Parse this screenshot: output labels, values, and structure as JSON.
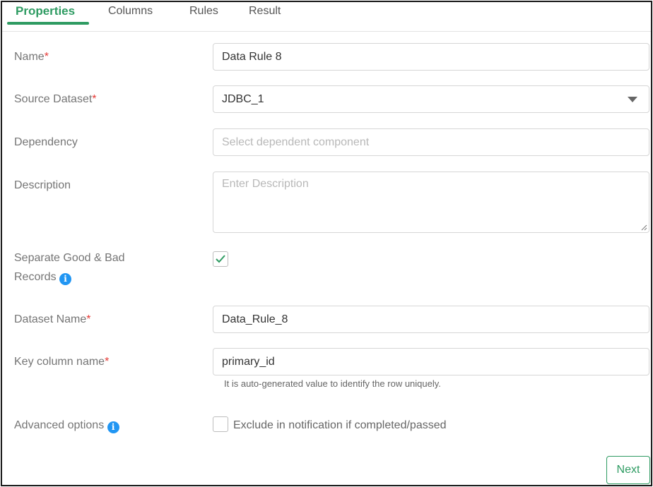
{
  "tabs": [
    {
      "label": "Properties",
      "active": true
    },
    {
      "label": "Columns",
      "active": false
    },
    {
      "label": "Rules",
      "active": false
    },
    {
      "label": "Result",
      "active": false
    }
  ],
  "form": {
    "name": {
      "label": "Name",
      "required_mark": "*",
      "value": "Data Rule 8"
    },
    "source_dataset": {
      "label": "Source Dataset",
      "required_mark": "*",
      "value": "JDBC_1"
    },
    "dependency": {
      "label": "Dependency",
      "placeholder": "Select dependent component"
    },
    "description": {
      "label": "Description",
      "placeholder": "Enter Description"
    },
    "separate_records": {
      "label_line1": "Separate Good & Bad",
      "label_line2": "Records",
      "checked": true
    },
    "dataset_name": {
      "label": "Dataset Name",
      "required_mark": "*",
      "value": "Data_Rule_8"
    },
    "key_column": {
      "label": "Key column name",
      "required_mark": "*",
      "value": "primary_id",
      "hint": "It is auto-generated value to identify the row uniquely."
    },
    "advanced": {
      "label": "Advanced options",
      "checkbox_label": "Exclude in notification if completed/passed",
      "checked": false
    }
  },
  "info_icon_glyph": "i",
  "next_label": "Next",
  "colors": {
    "accent": "#2e9b62",
    "required": "#e53935",
    "info": "#2196f3"
  }
}
